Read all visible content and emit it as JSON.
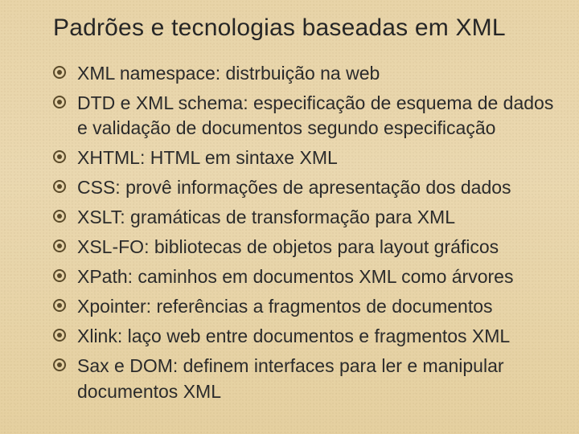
{
  "title": "Padrões e tecnologias baseadas em XML",
  "bullets": [
    "XML namespace: distrbuição na web",
    "DTD e XML schema: especificação de esquema de dados e validação de documentos segundo especificação",
    "XHTML: HTML em sintaxe XML",
    "CSS: provê informações de apresentação dos dados",
    "XSLT: gramáticas de transformação para XML",
    "XSL-FO: bibliotecas de objetos para layout gráficos",
    "XPath: caminhos em documentos XML como árvores",
    "Xpointer: referências a fragmentos de documentos",
    "Xlink: laço web entre documentos e fragmentos XML",
    "Sax e DOM: definem interfaces para ler e manipular documentos XML"
  ]
}
